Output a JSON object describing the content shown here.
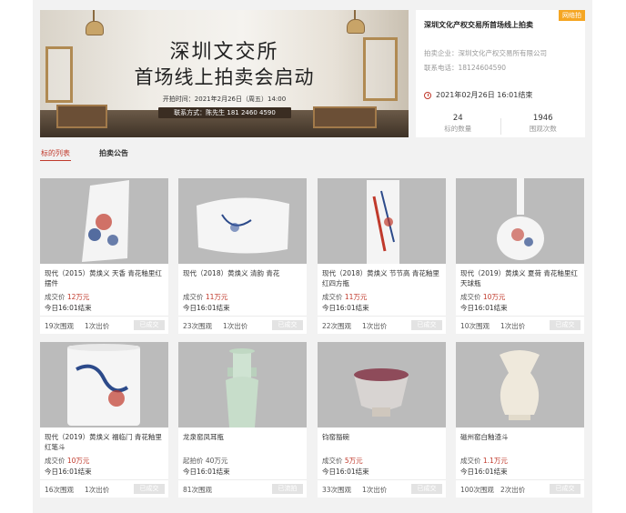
{
  "banner": {
    "line1": "深圳文交所",
    "line2": "首场线上拍卖会启动",
    "time": "开拍时间：2021年2月26日（周五）14:00",
    "contact": "联系方式：陈先生 181 2460 4590"
  },
  "auction": {
    "badge": "网络拍",
    "title": "深圳文化产权交易所首场线上拍卖",
    "organizer": "拍卖企业：深圳文化产权交易所有限公司",
    "phone": "联系电话：18124604590",
    "end_time": "2021年02月26日 16:01结束",
    "stats": [
      {
        "num": "24",
        "label": "标的数量"
      },
      {
        "num": "1946",
        "label": "围观次数"
      }
    ]
  },
  "tabs": {
    "items": [
      {
        "label": "标的列表",
        "active": true
      },
      {
        "label": "拍卖公告",
        "active": false
      }
    ]
  },
  "lots": [
    {
      "name": "现代（2015）黄焕义 天香 青花釉里红摆件",
      "price_label": "成交价",
      "price": "12万元",
      "price_red": true,
      "end": "今日16:01结束",
      "views": "19次围观",
      "bids": "1次出价",
      "status": "已成交",
      "img": "plaque"
    },
    {
      "name": "现代（2018）黄焕义 清韵 青花",
      "price_label": "成交价",
      "price": "11万元",
      "price_red": true,
      "end": "今日16:01结束",
      "views": "23次围观",
      "bids": "1次出价",
      "status": "已成交",
      "img": "plate"
    },
    {
      "name": "现代（2018）黄焕义 节节高 青花釉里红四方瓶",
      "price_label": "成交价",
      "price": "11万元",
      "price_red": true,
      "end": "今日16:01结束",
      "views": "22次围观",
      "bids": "1次出价",
      "status": "已成交",
      "img": "square"
    },
    {
      "name": "现代（2019）黄焕义 夏荷 青花釉里红天球瓶",
      "price_label": "成交价",
      "price": "10万元",
      "price_red": true,
      "end": "今日16:01结束",
      "views": "10次围观",
      "bids": "1次出价",
      "status": "已成交",
      "img": "globe"
    },
    {
      "name": "现代（2019）黄焕义 福临门 青花釉里红笔斗",
      "price_label": "成交价",
      "price": "10万元",
      "price_red": true,
      "end": "今日16:01结束",
      "views": "16次围观",
      "bids": "1次出价",
      "status": "已成交",
      "img": "brushpot"
    },
    {
      "name": "龙泉窑凤耳瓶",
      "price_label": "起拍价",
      "price": "40万元",
      "price_red": false,
      "end": "今日16:01结束",
      "views": "81次围观",
      "bids": "",
      "status": "已流拍",
      "img": "celadon"
    },
    {
      "name": "钧窑豁碗",
      "price_label": "成交价",
      "price": "5万元",
      "price_red": true,
      "end": "今日16:01结束",
      "views": "33次围观",
      "bids": "1次出价",
      "status": "已成交",
      "img": "bowl"
    },
    {
      "name": "磁州窑白釉渣斗",
      "price_label": "成交价",
      "price": "1.1万元",
      "price_red": true,
      "end": "今日16:01结束",
      "views": "100次围观",
      "bids": "2次出价",
      "status": "已成交",
      "img": "jar"
    }
  ],
  "colors": {
    "accent": "#c0392b",
    "badge": "#f5a623",
    "panel_bg": "#f2f2f2"
  }
}
